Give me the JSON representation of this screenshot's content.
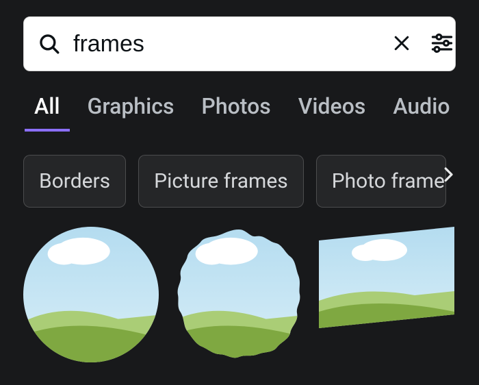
{
  "search": {
    "value": "frames"
  },
  "tabs": [
    {
      "label": "All",
      "active": true
    },
    {
      "label": "Graphics",
      "active": false
    },
    {
      "label": "Photos",
      "active": false
    },
    {
      "label": "Videos",
      "active": false
    },
    {
      "label": "Audio",
      "active": false
    }
  ],
  "chips": [
    {
      "label": "Borders"
    },
    {
      "label": "Picture frames"
    },
    {
      "label": "Photo frames"
    }
  ]
}
